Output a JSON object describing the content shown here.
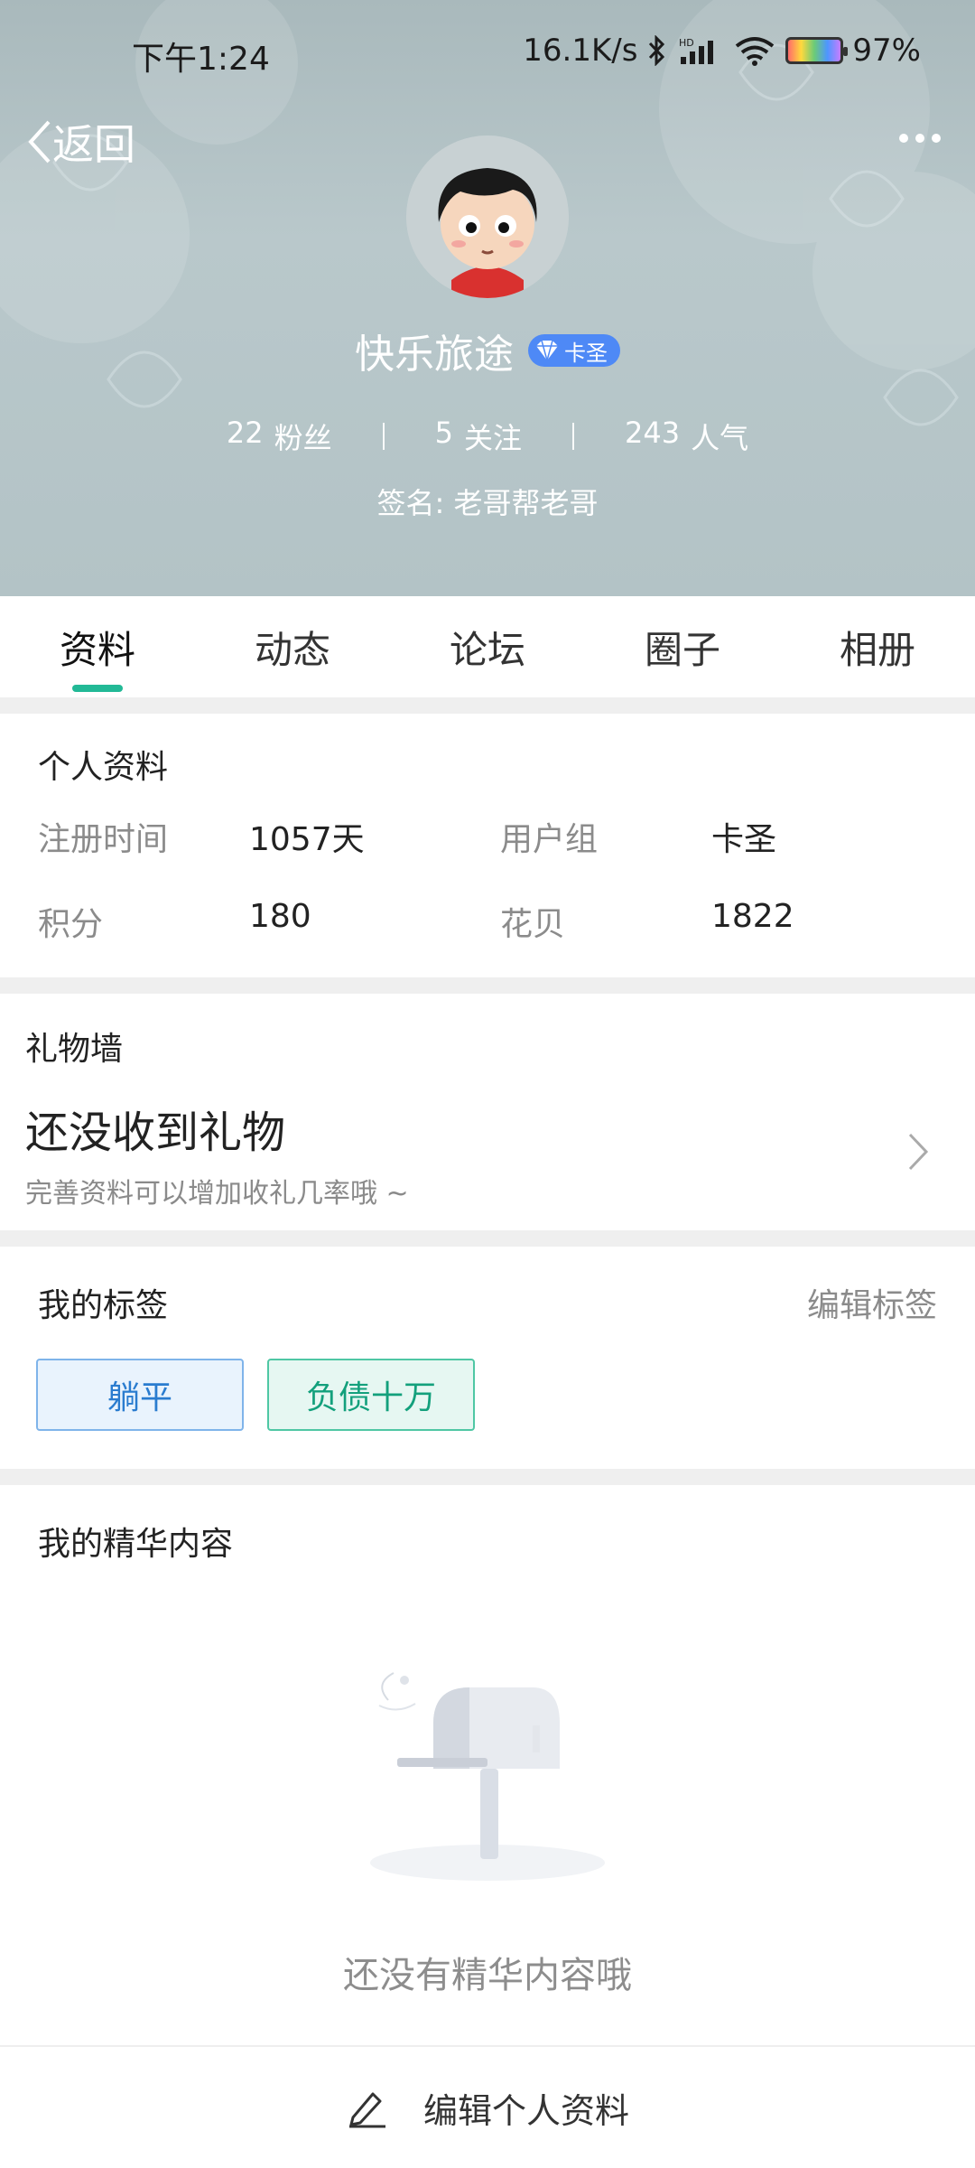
{
  "status_bar": {
    "time": "下午1:24",
    "network_speed": "16.1K/s",
    "battery": "97%",
    "icons": [
      "bluetooth-icon",
      "hd-signal-icon",
      "wifi-icon",
      "battery-icon"
    ]
  },
  "header": {
    "back_label": "返回",
    "username": "快乐旅途",
    "badge_label": "卡圣",
    "stats": [
      {
        "value": "22",
        "label": "粉丝"
      },
      {
        "value": "5",
        "label": "关注"
      },
      {
        "value": "243",
        "label": "人气"
      }
    ],
    "signature": "签名: 老哥帮老哥"
  },
  "tabs": [
    {
      "label": "资料",
      "active": true
    },
    {
      "label": "动态",
      "active": false
    },
    {
      "label": "论坛",
      "active": false
    },
    {
      "label": "圈子",
      "active": false
    },
    {
      "label": "相册",
      "active": false
    }
  ],
  "profile": {
    "title": "个人资料",
    "fields": [
      {
        "label": "注册时间",
        "value": "1057天"
      },
      {
        "label": "用户组",
        "value": "卡圣"
      },
      {
        "label": "积分",
        "value": "180"
      },
      {
        "label": "花贝",
        "value": "1822"
      }
    ]
  },
  "gift_wall": {
    "title": "礼物墙",
    "main": "还没收到礼物",
    "sub": "完善资料可以增加收礼几率哦 ~"
  },
  "tags": {
    "title": "我的标签",
    "edit_label": "编辑标签",
    "items": [
      {
        "label": "躺平",
        "color": "#2a7ccf"
      },
      {
        "label": "负债十万",
        "color": "#13a07c"
      }
    ]
  },
  "featured": {
    "title": "我的精华内容",
    "empty_text": "还没有精华内容哦"
  },
  "bottom": {
    "edit_profile_label": "编辑个人资料"
  },
  "colors": {
    "accent": "#22b996",
    "header_bg": "#b3c3c6",
    "badge_bg": "#4e89f6"
  }
}
